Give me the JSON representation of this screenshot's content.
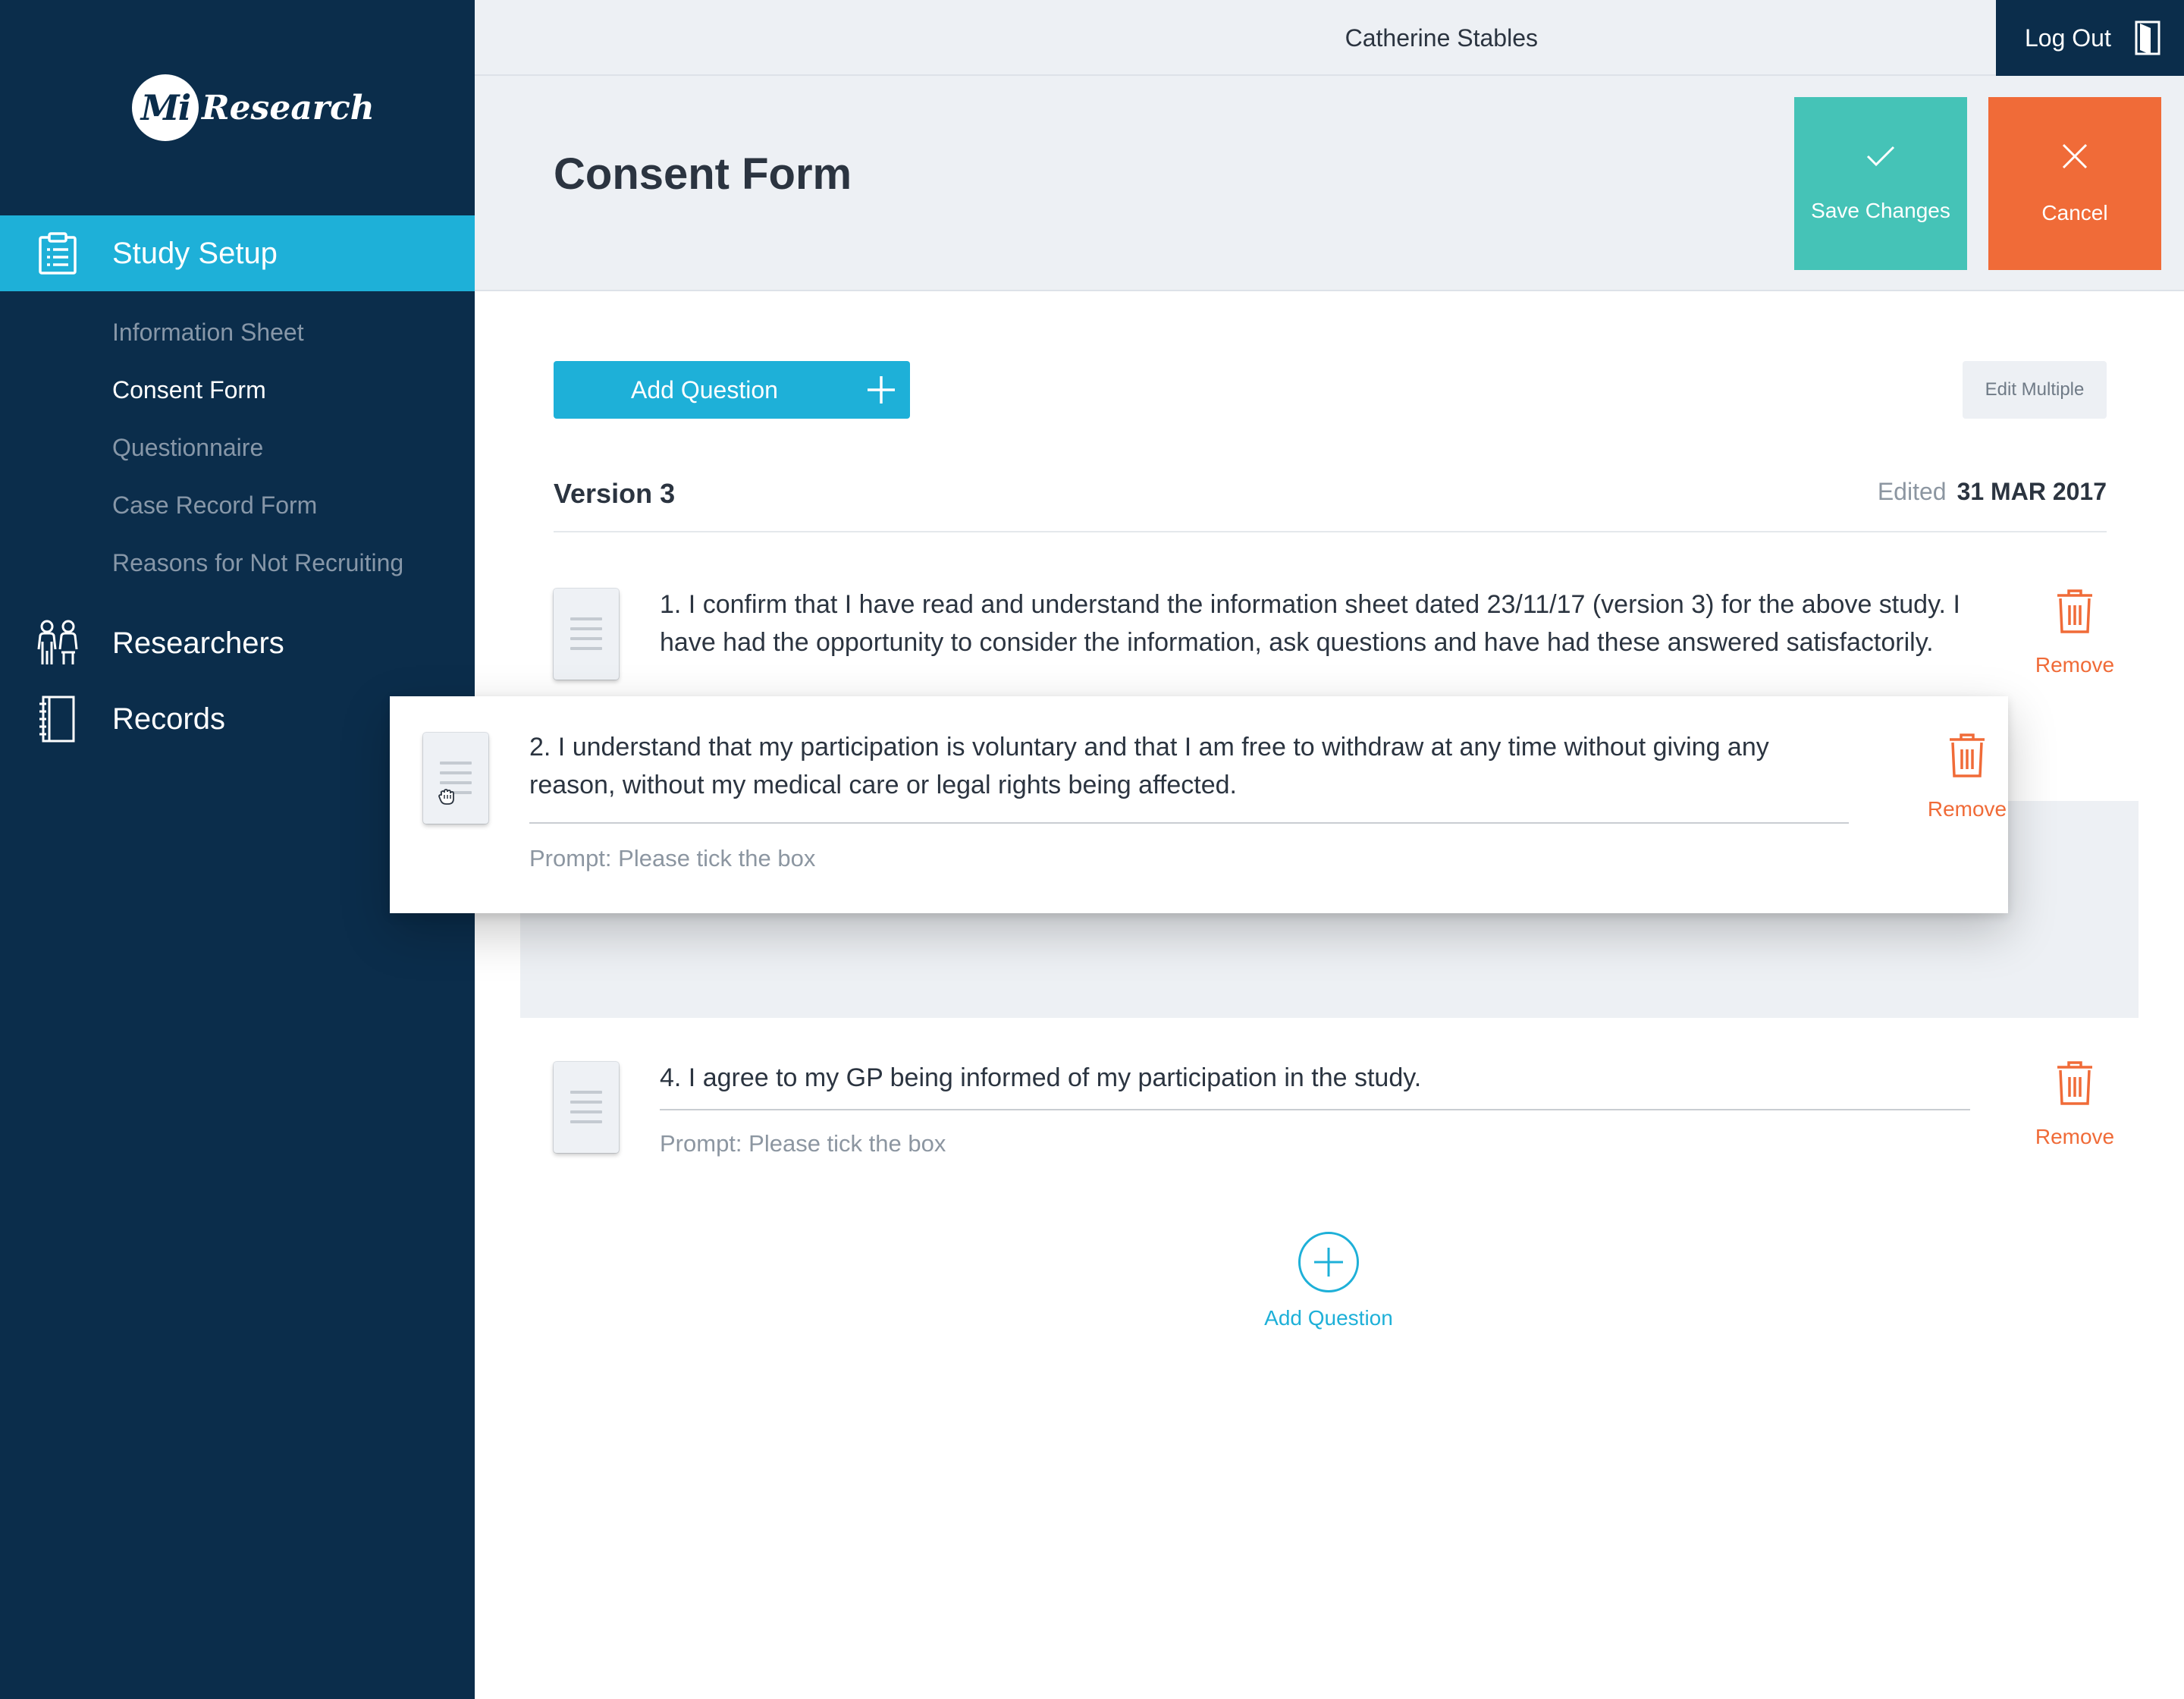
{
  "brand": {
    "logo_mark": "Mi",
    "logo_text": "Research"
  },
  "user": {
    "name": "Catherine Stables",
    "logout_label": "Log Out"
  },
  "sidebar": {
    "study_setup": {
      "label": "Study Setup",
      "icon": "clipboard-icon"
    },
    "sub_items": [
      {
        "label": "Information Sheet"
      },
      {
        "label": "Consent Form",
        "current": true
      },
      {
        "label": "Questionnaire"
      },
      {
        "label": "Case Record Form"
      },
      {
        "label": "Reasons for Not Recruiting"
      }
    ],
    "researchers": {
      "label": "Researchers",
      "icon": "people-icon"
    },
    "records": {
      "label": "Records",
      "icon": "notebook-icon"
    }
  },
  "page": {
    "title": "Consent Form",
    "save_label": "Save Changes",
    "cancel_label": "Cancel"
  },
  "toolbar": {
    "add_question_label": "Add Question",
    "edit_multiple_label": "Edit Multiple"
  },
  "version": {
    "label": "Version 3",
    "edited_label": "Edited",
    "edited_date": "31 MAR 2017"
  },
  "questions": [
    {
      "text": "1. I confirm that I have read and understand the information sheet dated 23/11/17 (version 3) for the above study.  I have had the opportunity to consider the information, ask questions and have had these answered satisfactorily.",
      "remove_label": "Remove"
    },
    {
      "text": "2. I understand that my participation is voluntary and that I am free to withdraw at any time without giving any reason, without my medical care or legal rights being affected.",
      "prompt": "Prompt: Please tick the box",
      "remove_label": "Remove",
      "state": "dragging"
    },
    {
      "text": "4. I agree to my GP being informed of my participation in the study.",
      "prompt": "Prompt: Please tick the box",
      "remove_label": "Remove"
    }
  ],
  "footer": {
    "add_question_label": "Add Question"
  },
  "colors": {
    "sidebar_bg": "#0b2d4b",
    "accent_blue": "#1eb0d8",
    "save_teal": "#45c3b7",
    "cancel_orange": "#f06b38",
    "header_bg": "#edf0f4"
  }
}
